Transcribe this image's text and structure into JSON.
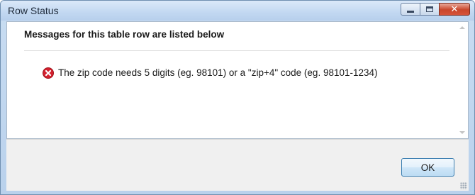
{
  "window": {
    "title": "Row Status"
  },
  "dialog": {
    "heading": "Messages for this table row are listed below",
    "messages": [
      {
        "icon": "error-icon",
        "text": "The zip code needs 5 digits (eg. 98101) or a \"zip+4\" code (eg. 98101-1234)"
      }
    ]
  },
  "footer": {
    "ok_label": "OK"
  },
  "colors": {
    "error": "#d3202e",
    "titlebar": "#c2d8f1",
    "close_button": "#c9462c",
    "ok_border": "#3c7fb1"
  }
}
